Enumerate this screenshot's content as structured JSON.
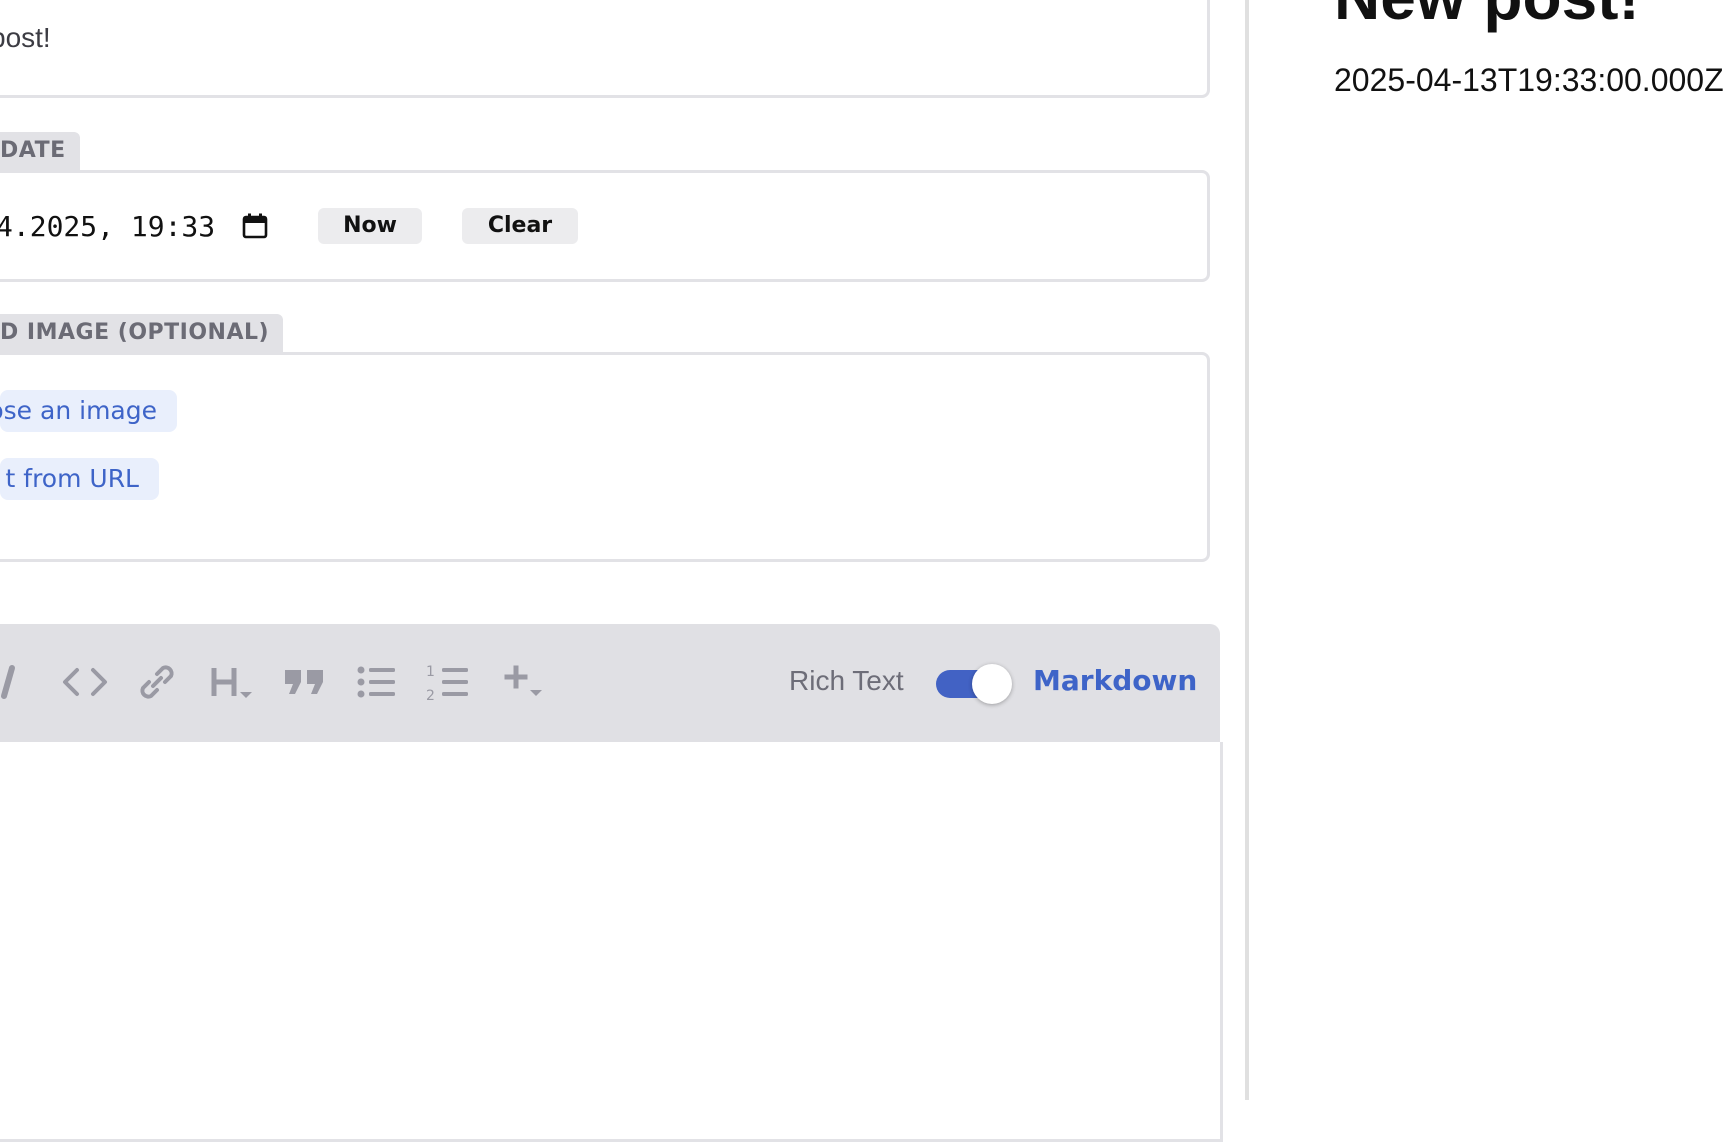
{
  "editor": {
    "description_value": "post!",
    "date_field": {
      "label": "DATE",
      "value": "4.2025, 19:33",
      "now_button": "Now",
      "clear_button": "Clear"
    },
    "image_field": {
      "label": "D IMAGE (OPTIONAL)",
      "choose_button": "ose an image",
      "insert_url_button": "t from URL"
    },
    "body_editor": {
      "toolbar": {
        "icons": [
          "italic-icon",
          "code-icon",
          "link-icon",
          "heading-icon",
          "quote-icon",
          "bulleted-list-icon",
          "numbered-list-icon",
          "add-icon"
        ],
        "rich_text_label": "Rich Text",
        "markdown_label": "Markdown",
        "mode": "Markdown"
      }
    }
  },
  "preview": {
    "title": "New post!",
    "date": "2025-04-13T19:33:00.000Z"
  },
  "colors": {
    "accent": "#4262c4",
    "label_bg": "#e2e2e6",
    "toolbar_bg": "#e0e0e4",
    "image_button_bg": "#e9effc"
  }
}
